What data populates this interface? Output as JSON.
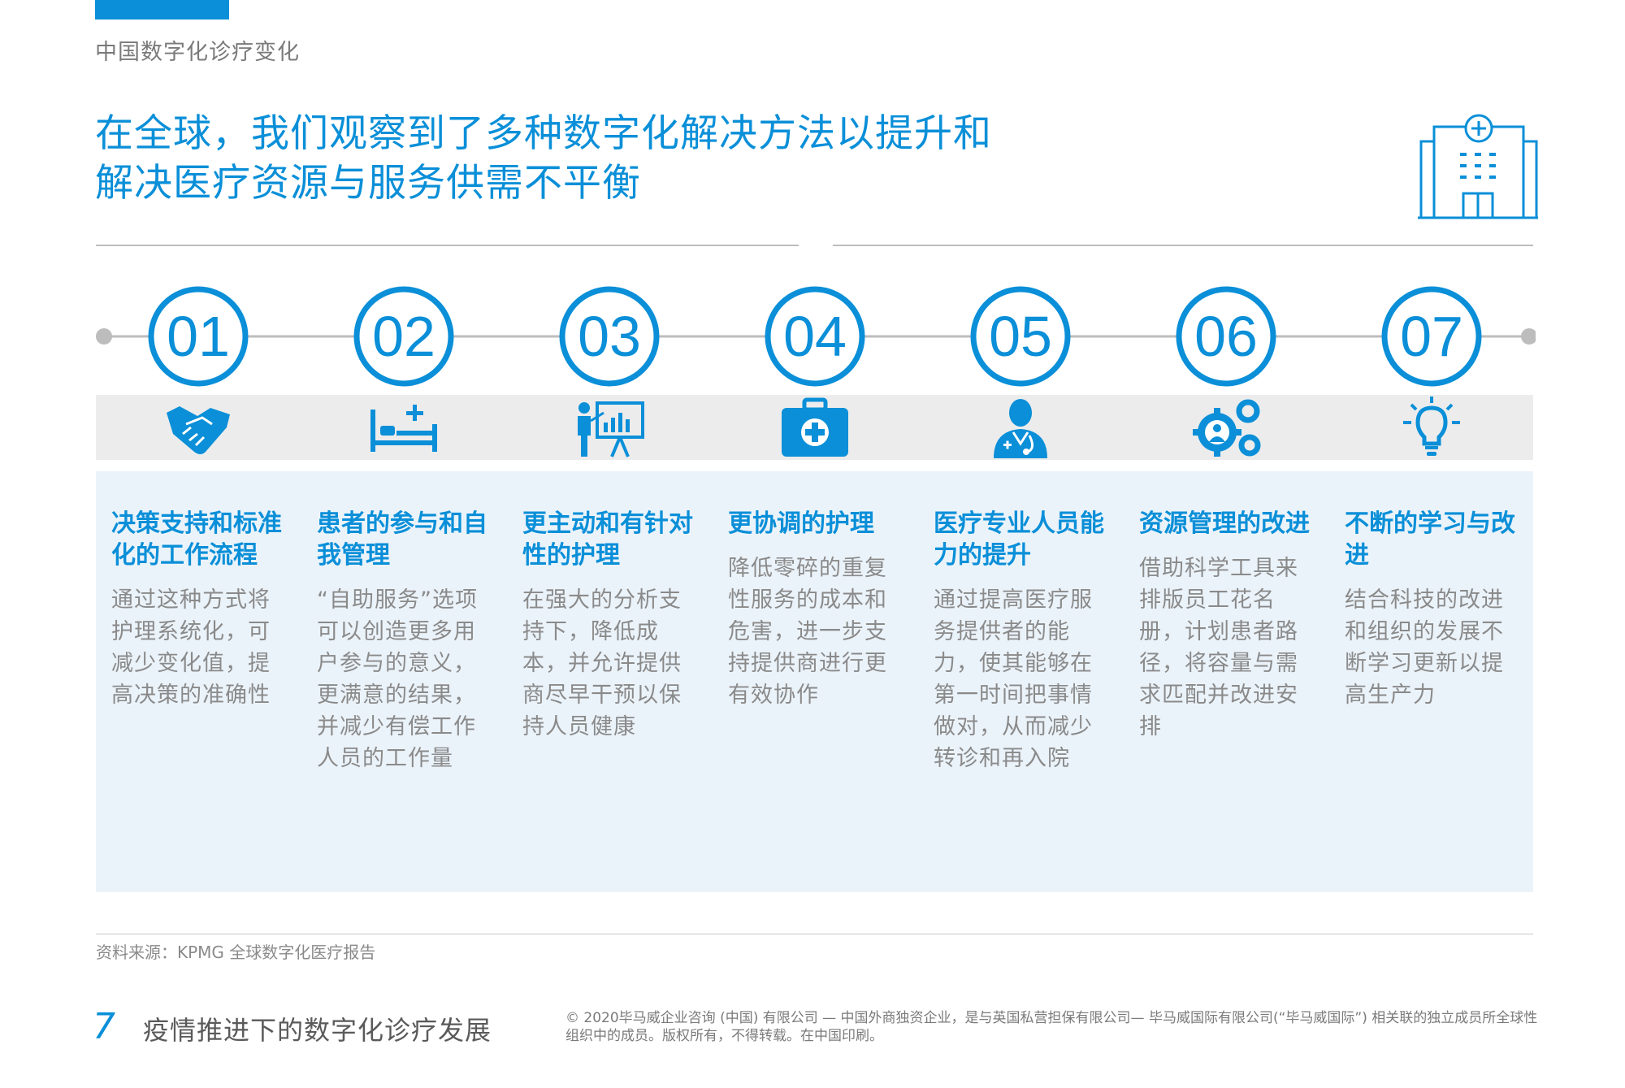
{
  "header": {
    "section_label": "中国数字化诊疗变化",
    "title_line_1": "在全球，我们观察到了多种数字化解决方法以提升和",
    "title_line_2": "解决医疗资源与服务供需不平衡",
    "header_icon": "hospital-building-icon"
  },
  "colors": {
    "accent": "#0a8fd8",
    "band": "#ececec",
    "panel": "#ebf3fa",
    "body_text": "#8a8a8a"
  },
  "steps": [
    {
      "number": "01",
      "icon": "handshake-icon",
      "heading": "决策支持和标准化的工作流程",
      "body": "通过这种方式将护理系统化，可减少变化值，提高决策的准确性"
    },
    {
      "number": "02",
      "icon": "hospital-bed-icon",
      "heading": "患者的参与和自我管理",
      "body": "“自助服务”选项可以创造更多用户参与的意义，更满意的结果，并减少有偿工作人员的工作量"
    },
    {
      "number": "03",
      "icon": "presentation-chart-icon",
      "heading": "更主动和有针对性的护理",
      "body": "在强大的分析支持下，降低成本，并允许提供商尽早干预以保持人员健康"
    },
    {
      "number": "04",
      "icon": "first-aid-kit-icon",
      "heading": "更协调的护理",
      "body": "降低零碎的重复性服务的成本和危害，进一步支持提供商进行更有效协作"
    },
    {
      "number": "05",
      "icon": "doctor-stethoscope-icon",
      "heading": "医疗专业人员能力的提升",
      "body": "通过提高医疗服务提供者的能力，使其能够在第一时间把事情做对，从而减少转诊和再入院"
    },
    {
      "number": "06",
      "icon": "gears-person-icon",
      "heading": "资源管理的改进",
      "body": "借助科学工具来排版员工花名册，计划患者路径，将容量与需求匹配并改进安排"
    },
    {
      "number": "07",
      "icon": "lightbulb-icon",
      "heading": "不断的学习与改进",
      "body": "结合科技的改进和组织的发展不断学习更新以提高生产力"
    }
  ],
  "footer": {
    "source": "资料来源：KPMG 全球数字化医疗报告",
    "page_number": "7",
    "title": "疫情推进下的数字化诊疗发展",
    "copyright": "© 2020毕马威企业咨询 (中国) 有限公司 — 中国外商独资企业，是与英国私营担保有限公司— 毕马威国际有限公司(“毕马威国际”) 相关联的独立成员所全球性组织中的成员。版权所有，不得转载。在中国印刷。"
  }
}
